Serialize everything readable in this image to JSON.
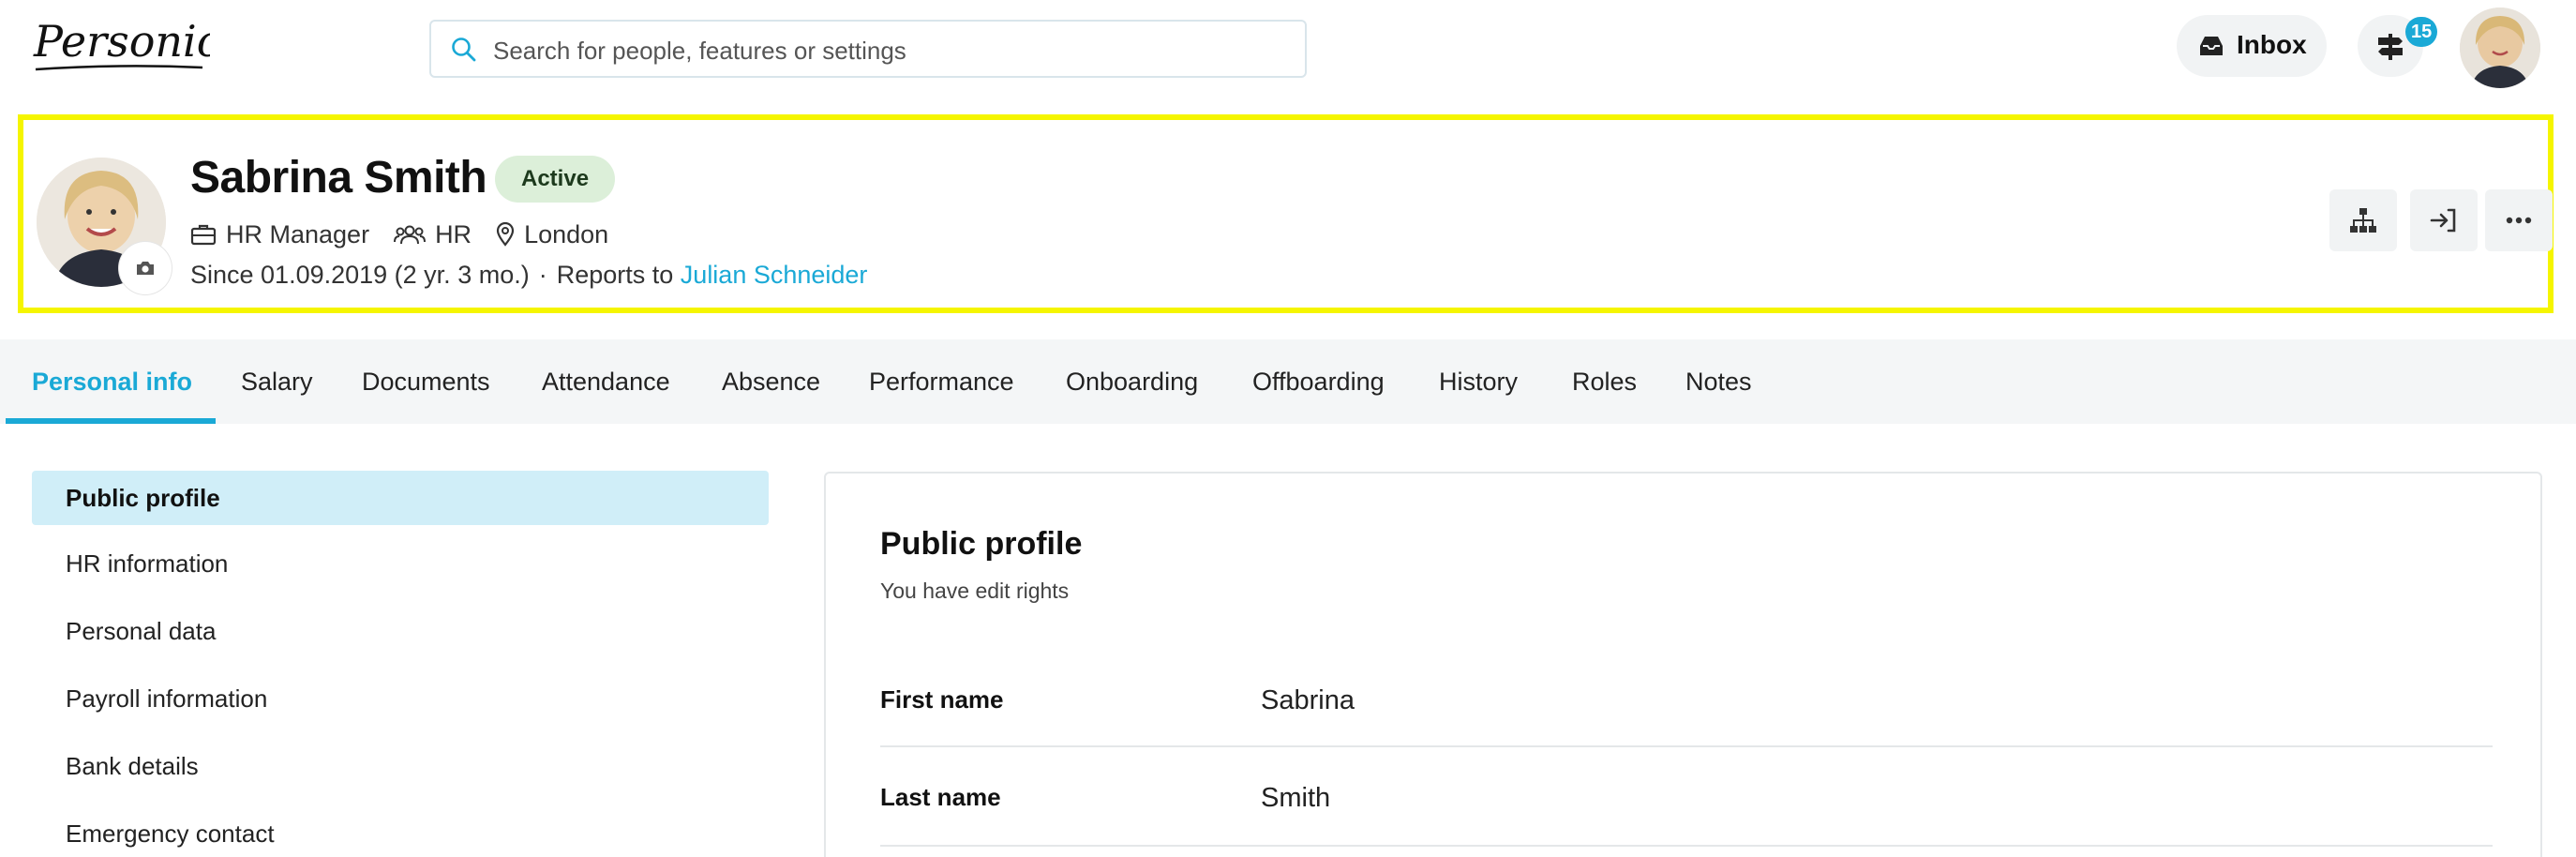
{
  "topbar": {
    "logo_text": "Personio",
    "search_placeholder": "Search for people, features or settings",
    "inbox_label": "Inbox",
    "notification_count": "15",
    "accent_color": "#1aa9d6"
  },
  "profile": {
    "name": "Sabrina Smith",
    "status": "Active",
    "position": "HR Manager",
    "department": "HR",
    "office": "London",
    "since": "Since 01.09.2019 (2 yr. 3 mo.)",
    "separator": "·",
    "reports_to_label": "Reports to",
    "reports_to_name": "Julian Schneider",
    "actions": [
      "org-chart-icon",
      "login-as-icon",
      "more-icon"
    ]
  },
  "tabs": [
    {
      "label": "Personal info",
      "active": true
    },
    {
      "label": "Salary"
    },
    {
      "label": "Documents"
    },
    {
      "label": "Attendance"
    },
    {
      "label": "Absence"
    },
    {
      "label": "Performance"
    },
    {
      "label": "Onboarding"
    },
    {
      "label": "Offboarding"
    },
    {
      "label": "History"
    },
    {
      "label": "Roles"
    },
    {
      "label": "Notes"
    }
  ],
  "subnav": [
    {
      "label": "Public profile",
      "active": true
    },
    {
      "label": "HR information"
    },
    {
      "label": "Personal data"
    },
    {
      "label": "Payroll information"
    },
    {
      "label": "Bank details"
    },
    {
      "label": "Emergency contact"
    }
  ],
  "card": {
    "title": "Public profile",
    "subtitle": "You have edit rights",
    "fields": [
      {
        "label": "First name",
        "value": "Sabrina"
      },
      {
        "label": "Last name",
        "value": "Smith"
      }
    ]
  }
}
